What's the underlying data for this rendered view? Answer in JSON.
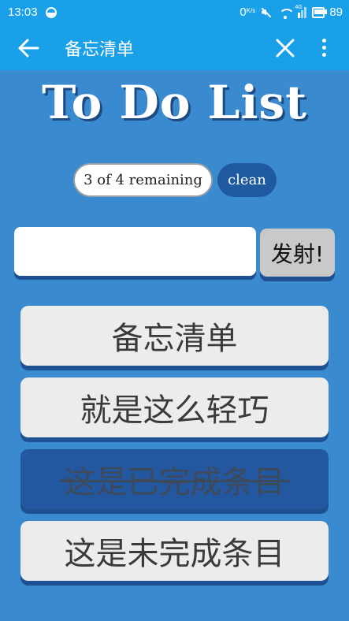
{
  "status_bar": {
    "time": "13:03",
    "net_speed": "0",
    "net_speed_unit": "K/s",
    "signal_label": "4G",
    "battery": "89"
  },
  "app_bar": {
    "title": "备忘清单"
  },
  "heading": "To Do List",
  "counter_text": "3 of 4 remaining",
  "clean_label": "clean",
  "input": {
    "value": "",
    "placeholder": ""
  },
  "submit_label": "发射!",
  "items": [
    {
      "text": "备忘清单",
      "done": false
    },
    {
      "text": "就是这么轻巧",
      "done": false
    },
    {
      "text": "这是已完成条目",
      "done": true
    },
    {
      "text": "这是未完成条目",
      "done": false
    }
  ],
  "colors": {
    "app_bar": "#1aa0e8",
    "background": "#3a8ad0",
    "done_item": "#2358a0",
    "accent_dark": "#1f5aa0"
  }
}
